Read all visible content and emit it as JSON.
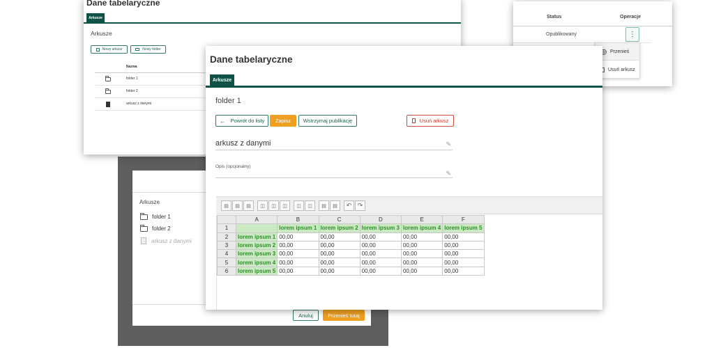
{
  "bg_window": {
    "title": "Dane tabelaryczne",
    "tab": "Arkusze",
    "section": "Arkusze",
    "new_sheet_btn": "Nowy arkusz",
    "new_folder_btn": "Nowy folder",
    "column_name": "Nazwa",
    "rows": [
      {
        "icon": "folder-icon",
        "name": "folder 1"
      },
      {
        "icon": "folder-icon",
        "name": "folder 2"
      },
      {
        "icon": "document-icon",
        "name": "arkusz z danymi"
      }
    ]
  },
  "status_window": {
    "col_status": "Status",
    "col_operations": "Operacje",
    "status_value": "Opublikowany",
    "menu": [
      {
        "icon": "move-icon",
        "label": "Przenieś"
      },
      {
        "icon": "trash-icon",
        "label": "Usuń arkusz"
      }
    ]
  },
  "move_dialog": {
    "section": "Arkusze",
    "items": [
      {
        "name": "folder 1",
        "disabled": false
      },
      {
        "name": "folder 2",
        "disabled": false
      },
      {
        "name": "arkusz z danymi",
        "disabled": true
      }
    ],
    "cancel": "Anuluj",
    "confirm": "Przenieś tutaj"
  },
  "main_window": {
    "title": "Dane tabelaryczne",
    "tab": "Arkusze",
    "folder_title": "folder 1",
    "back_btn": "Powrót do listy",
    "save_btn": "Zapisz",
    "pause_btn": "Wstrzymaj publikację",
    "delete_btn": "Usuń arkusz",
    "sheet_name": "arkusz z danymi",
    "desc_label": "Opis (opcjonalny)",
    "spreadsheet": {
      "columns": [
        "A",
        "B",
        "C",
        "D",
        "E",
        "F"
      ],
      "rows": [
        {
          "n": "1",
          "cells": [
            "",
            "lorem ipsum 1",
            "lorem ipsum 2",
            "lorem ipsum 3",
            "lorem ipsum 4",
            "lorem ipsum 5"
          ]
        },
        {
          "n": "2",
          "cells": [
            "lorem ipsum 1",
            "00,00",
            "00,00",
            "00,00",
            "00,00",
            "00,00"
          ]
        },
        {
          "n": "3",
          "cells": [
            "lorem ipsum 2",
            "00,00",
            "00,00",
            "00,00",
            "00,00",
            "00,00"
          ]
        },
        {
          "n": "4",
          "cells": [
            "lorem ipsum 3",
            "00,00",
            "00,00",
            "00,00",
            "00,00",
            "00,00"
          ]
        },
        {
          "n": "5",
          "cells": [
            "lorem ipsum 4",
            "00,00",
            "00,00",
            "00,00",
            "00,00",
            "00,00"
          ]
        },
        {
          "n": "6",
          "cells": [
            "lorem ipsum 5",
            "00,00",
            "00,00",
            "00,00",
            "00,00",
            "00,00"
          ]
        }
      ]
    }
  }
}
